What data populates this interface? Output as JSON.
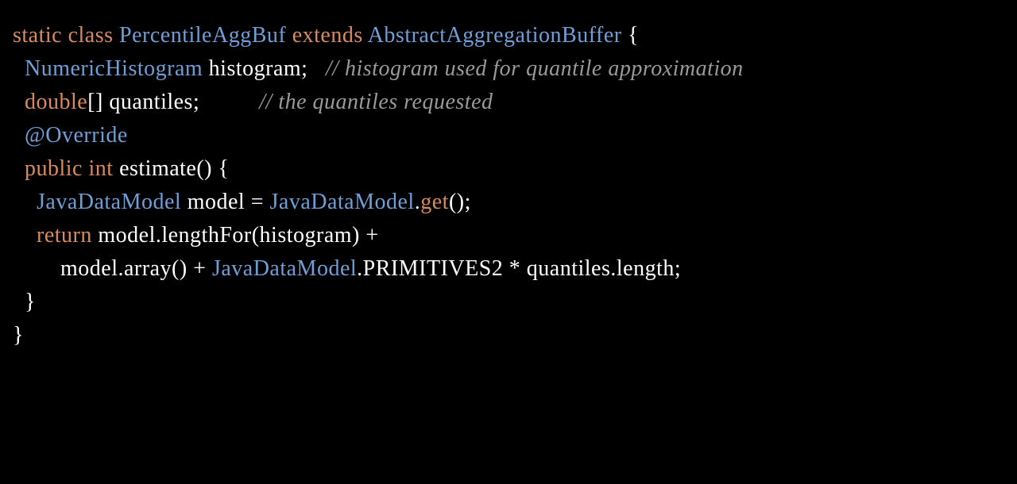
{
  "tokens": {
    "t01": "static",
    "t02": " ",
    "t03": "class",
    "t04": " ",
    "t05": "PercentileAggBuf",
    "t06": " ",
    "t07": "extends",
    "t08": " ",
    "t09": "AbstractAggregationBuffer",
    "t10": " {",
    "t11": "\n  ",
    "t12": "NumericHistogram",
    "t13": " histogram;   ",
    "t14": "// histogram used for quantile approximation",
    "t15": "\n  ",
    "t16": "double",
    "t17": "[] quantiles;          ",
    "t18": "// the quantiles requested",
    "t19": "\n  ",
    "t20": "@Override",
    "t21": "\n  ",
    "t22": "public",
    "t23": " ",
    "t24": "int",
    "t25": " estimate() {",
    "t26": "\n    ",
    "t27": "JavaDataModel",
    "t28": " model = ",
    "t29": "JavaDataModel",
    "t30": ".",
    "t31": "get",
    "t32": "();",
    "t33": "\n    ",
    "t34": "return",
    "t35": " model.lengthFor(histogram) +",
    "t36": "\n        model.array() + ",
    "t37": "JavaDataModel",
    "t38": ".PRIMITIVES2 * quantiles.length;",
    "t39": "\n  }",
    "t40": "\n}"
  }
}
